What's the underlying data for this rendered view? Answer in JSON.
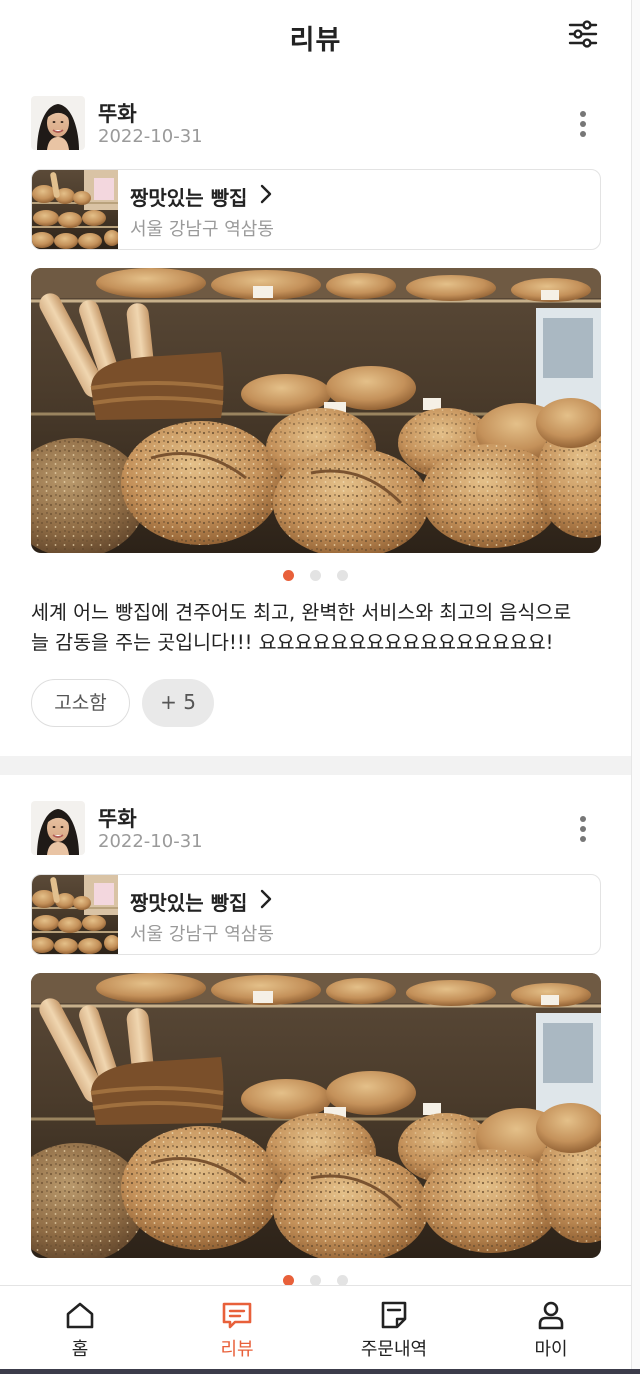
{
  "header": {
    "title": "리뷰",
    "filter_icon": "sliders-icon"
  },
  "colors": {
    "accent": "#e8603a",
    "muted": "#9a9a9a",
    "border": "#e3e3e3"
  },
  "reviews": [
    {
      "user_name": "뚜화",
      "date": "2022-10-31",
      "store": {
        "name": "짱맛있는 빵집",
        "address": "서울 강남구 역삼동"
      },
      "photo_count": 3,
      "active_photo": 1,
      "text": "세계 어느 빵집에 견주어도 최고, 완벽한 서비스와 최고의 음식으로\n늘 감동을 주는 곳입니다!!! 요요요요요요요요요요요요요요요요!",
      "tags": [
        "고소함"
      ],
      "more_tags": "+ 5"
    },
    {
      "user_name": "뚜화",
      "date": "2022-10-31",
      "store": {
        "name": "짱맛있는 빵집",
        "address": "서울 강남구 역삼동"
      },
      "photo_count": 3,
      "active_photo": 1
    }
  ],
  "nav": [
    {
      "label": "홈",
      "icon": "home-icon",
      "active": false
    },
    {
      "label": "리뷰",
      "icon": "review-icon",
      "active": true
    },
    {
      "label": "주문내역",
      "icon": "order-history-icon",
      "active": false
    },
    {
      "label": "마이",
      "icon": "user-icon",
      "active": false
    }
  ]
}
